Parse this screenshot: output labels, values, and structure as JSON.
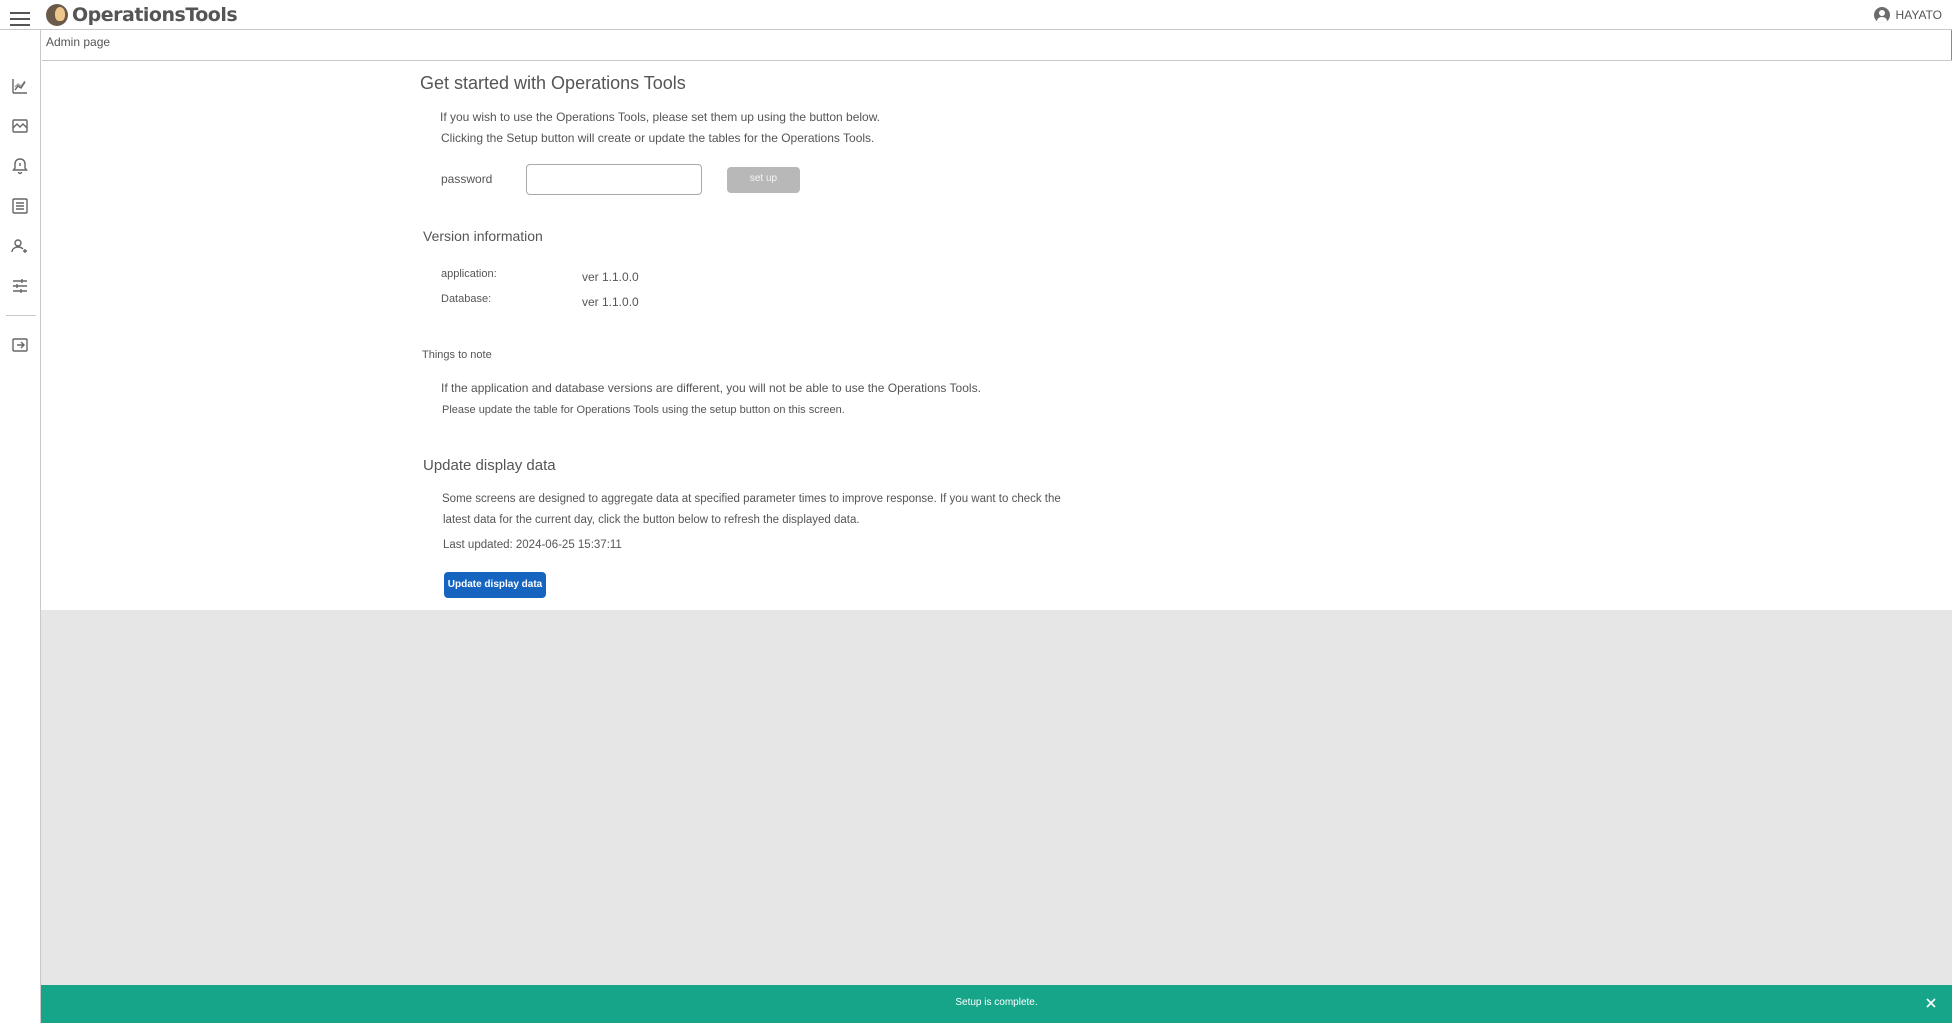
{
  "header": {
    "app_name": "OperationsTools",
    "user_name": "HAYATO"
  },
  "breadcrumb": "Admin page",
  "sidebar": {
    "items": [
      {
        "icon": "line-chart-icon"
      },
      {
        "icon": "image-chart-icon"
      },
      {
        "icon": "alert-bell-icon"
      },
      {
        "icon": "list-document-icon"
      },
      {
        "icon": "user-settings-icon"
      },
      {
        "icon": "sliders-icon"
      },
      {
        "icon": "logout-icon"
      }
    ]
  },
  "setup": {
    "title": "Get started with Operations Tools",
    "desc1": "If you wish to use the Operations Tools, please set them up using the button below.",
    "desc2": "Clicking the Setup button will create or update the tables for the Operations Tools.",
    "password_label": "password",
    "password_value": "",
    "setup_button": "set up"
  },
  "version": {
    "title": "Version information",
    "app_label": "application:",
    "app_value": "ver 1.1.0.0",
    "db_label": "Database:",
    "db_value": "ver 1.1.0.0"
  },
  "notes": {
    "title": "Things to note",
    "line1": "If the application and database versions are different, you will not be able to use the Operations Tools.",
    "line2": "Please update the table for Operations Tools using the setup button on this screen."
  },
  "update": {
    "title": "Update display data",
    "desc1": "Some screens are designed to aggregate data at specified parameter times to improve response. If you want to check the",
    "desc2": "latest data for the current day, click the button below to refresh the displayed data.",
    "last_updated": "Last updated: 2024-06-25 15:37:11",
    "button": "Update display data"
  },
  "toast": {
    "message": "Setup is complete."
  },
  "colors": {
    "primary": "#1565c0",
    "toast": "#17a589",
    "disabled_button": "#b8b8b8",
    "background_gray": "#e6e6e6"
  }
}
